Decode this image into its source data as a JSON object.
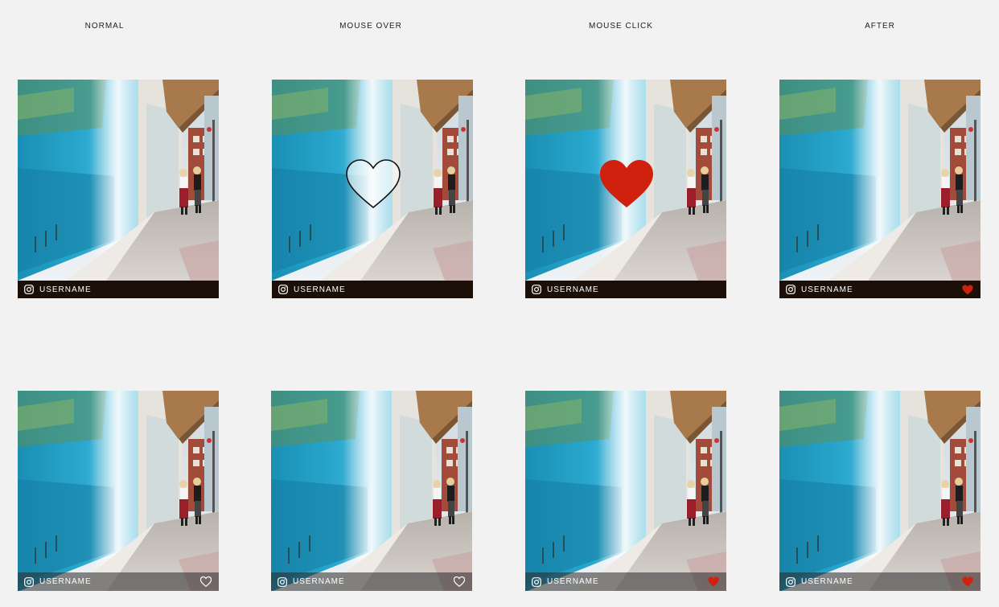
{
  "columns": [
    {
      "label": "NORMAL"
    },
    {
      "label": "MOUSE OVER"
    },
    {
      "label": "MOUSE CLICK"
    },
    {
      "label": "AFTER"
    }
  ],
  "cards": [
    {
      "username": "USERNAME",
      "overlay_heart": "none",
      "caption_heart": "none"
    },
    {
      "username": "USERNAME",
      "overlay_heart": "outline",
      "caption_heart": "none"
    },
    {
      "username": "USERNAME",
      "overlay_heart": "filled",
      "caption_heart": "none"
    },
    {
      "username": "USERNAME",
      "overlay_heart": "none",
      "caption_heart": "filled"
    },
    {
      "username": "USERNAME",
      "overlay_heart": "none",
      "caption_heart": "outline"
    },
    {
      "username": "USERNAME",
      "overlay_heart": "none",
      "caption_heart": "outline"
    },
    {
      "username": "USERNAME",
      "overlay_heart": "none",
      "caption_heart": "filled"
    },
    {
      "username": "USERNAME",
      "overlay_heart": "none",
      "caption_heart": "filled"
    }
  ],
  "icons": {
    "caption_left": "instagram-icon",
    "like": "heart-icon"
  },
  "colors": {
    "background": "#f2f2f2",
    "heart_red": "#d0210f",
    "caption_dark": "#1b0f08"
  }
}
